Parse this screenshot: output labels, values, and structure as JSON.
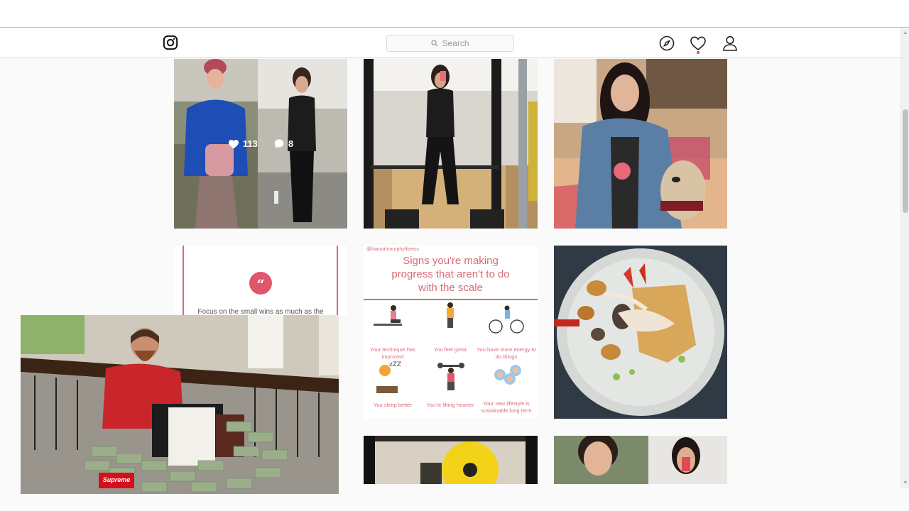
{
  "header": {
    "search_placeholder": "Search"
  },
  "posts": [
    {
      "likes": "113",
      "comments": "8"
    }
  ],
  "infographic": {
    "handle": "@hannahmurphyfitness",
    "title_line1": "Signs you're making",
    "title_line2": "progress that aren't to do",
    "title_line3": "with the scale",
    "captions": [
      "Your technique has improved",
      "You feel great",
      "You have more energy to do things",
      "You sleep better",
      "You're lifting heavier",
      "Your new lifestyle is sustainable long term"
    ]
  },
  "quote_post": {
    "text": "Focus on the small wins as much as the"
  },
  "webcam": {
    "brand_box": "Supreme"
  },
  "colors": {
    "accent": "#ed4956",
    "pink": "#d96a78"
  }
}
